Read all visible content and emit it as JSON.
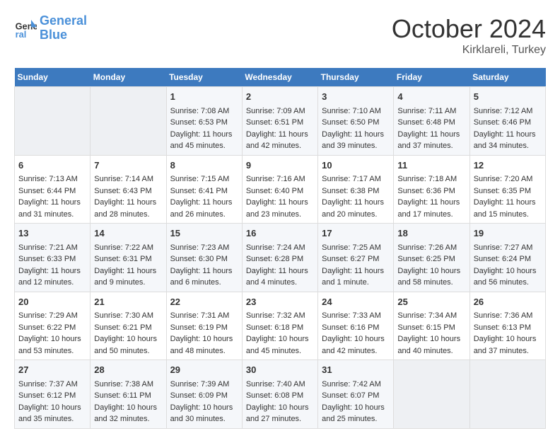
{
  "header": {
    "logo_line1": "General",
    "logo_line2": "Blue",
    "month": "October 2024",
    "location": "Kirklareli, Turkey"
  },
  "days_of_week": [
    "Sunday",
    "Monday",
    "Tuesday",
    "Wednesday",
    "Thursday",
    "Friday",
    "Saturday"
  ],
  "weeks": [
    [
      {
        "day": "",
        "data": []
      },
      {
        "day": "",
        "data": []
      },
      {
        "day": "1",
        "data": [
          "Sunrise: 7:08 AM",
          "Sunset: 6:53 PM",
          "Daylight: 11 hours and 45 minutes."
        ]
      },
      {
        "day": "2",
        "data": [
          "Sunrise: 7:09 AM",
          "Sunset: 6:51 PM",
          "Daylight: 11 hours and 42 minutes."
        ]
      },
      {
        "day": "3",
        "data": [
          "Sunrise: 7:10 AM",
          "Sunset: 6:50 PM",
          "Daylight: 11 hours and 39 minutes."
        ]
      },
      {
        "day": "4",
        "data": [
          "Sunrise: 7:11 AM",
          "Sunset: 6:48 PM",
          "Daylight: 11 hours and 37 minutes."
        ]
      },
      {
        "day": "5",
        "data": [
          "Sunrise: 7:12 AM",
          "Sunset: 6:46 PM",
          "Daylight: 11 hours and 34 minutes."
        ]
      }
    ],
    [
      {
        "day": "6",
        "data": [
          "Sunrise: 7:13 AM",
          "Sunset: 6:44 PM",
          "Daylight: 11 hours and 31 minutes."
        ]
      },
      {
        "day": "7",
        "data": [
          "Sunrise: 7:14 AM",
          "Sunset: 6:43 PM",
          "Daylight: 11 hours and 28 minutes."
        ]
      },
      {
        "day": "8",
        "data": [
          "Sunrise: 7:15 AM",
          "Sunset: 6:41 PM",
          "Daylight: 11 hours and 26 minutes."
        ]
      },
      {
        "day": "9",
        "data": [
          "Sunrise: 7:16 AM",
          "Sunset: 6:40 PM",
          "Daylight: 11 hours and 23 minutes."
        ]
      },
      {
        "day": "10",
        "data": [
          "Sunrise: 7:17 AM",
          "Sunset: 6:38 PM",
          "Daylight: 11 hours and 20 minutes."
        ]
      },
      {
        "day": "11",
        "data": [
          "Sunrise: 7:18 AM",
          "Sunset: 6:36 PM",
          "Daylight: 11 hours and 17 minutes."
        ]
      },
      {
        "day": "12",
        "data": [
          "Sunrise: 7:20 AM",
          "Sunset: 6:35 PM",
          "Daylight: 11 hours and 15 minutes."
        ]
      }
    ],
    [
      {
        "day": "13",
        "data": [
          "Sunrise: 7:21 AM",
          "Sunset: 6:33 PM",
          "Daylight: 11 hours and 12 minutes."
        ]
      },
      {
        "day": "14",
        "data": [
          "Sunrise: 7:22 AM",
          "Sunset: 6:31 PM",
          "Daylight: 11 hours and 9 minutes."
        ]
      },
      {
        "day": "15",
        "data": [
          "Sunrise: 7:23 AM",
          "Sunset: 6:30 PM",
          "Daylight: 11 hours and 6 minutes."
        ]
      },
      {
        "day": "16",
        "data": [
          "Sunrise: 7:24 AM",
          "Sunset: 6:28 PM",
          "Daylight: 11 hours and 4 minutes."
        ]
      },
      {
        "day": "17",
        "data": [
          "Sunrise: 7:25 AM",
          "Sunset: 6:27 PM",
          "Daylight: 11 hours and 1 minute."
        ]
      },
      {
        "day": "18",
        "data": [
          "Sunrise: 7:26 AM",
          "Sunset: 6:25 PM",
          "Daylight: 10 hours and 58 minutes."
        ]
      },
      {
        "day": "19",
        "data": [
          "Sunrise: 7:27 AM",
          "Sunset: 6:24 PM",
          "Daylight: 10 hours and 56 minutes."
        ]
      }
    ],
    [
      {
        "day": "20",
        "data": [
          "Sunrise: 7:29 AM",
          "Sunset: 6:22 PM",
          "Daylight: 10 hours and 53 minutes."
        ]
      },
      {
        "day": "21",
        "data": [
          "Sunrise: 7:30 AM",
          "Sunset: 6:21 PM",
          "Daylight: 10 hours and 50 minutes."
        ]
      },
      {
        "day": "22",
        "data": [
          "Sunrise: 7:31 AM",
          "Sunset: 6:19 PM",
          "Daylight: 10 hours and 48 minutes."
        ]
      },
      {
        "day": "23",
        "data": [
          "Sunrise: 7:32 AM",
          "Sunset: 6:18 PM",
          "Daylight: 10 hours and 45 minutes."
        ]
      },
      {
        "day": "24",
        "data": [
          "Sunrise: 7:33 AM",
          "Sunset: 6:16 PM",
          "Daylight: 10 hours and 42 minutes."
        ]
      },
      {
        "day": "25",
        "data": [
          "Sunrise: 7:34 AM",
          "Sunset: 6:15 PM",
          "Daylight: 10 hours and 40 minutes."
        ]
      },
      {
        "day": "26",
        "data": [
          "Sunrise: 7:36 AM",
          "Sunset: 6:13 PM",
          "Daylight: 10 hours and 37 minutes."
        ]
      }
    ],
    [
      {
        "day": "27",
        "data": [
          "Sunrise: 7:37 AM",
          "Sunset: 6:12 PM",
          "Daylight: 10 hours and 35 minutes."
        ]
      },
      {
        "day": "28",
        "data": [
          "Sunrise: 7:38 AM",
          "Sunset: 6:11 PM",
          "Daylight: 10 hours and 32 minutes."
        ]
      },
      {
        "day": "29",
        "data": [
          "Sunrise: 7:39 AM",
          "Sunset: 6:09 PM",
          "Daylight: 10 hours and 30 minutes."
        ]
      },
      {
        "day": "30",
        "data": [
          "Sunrise: 7:40 AM",
          "Sunset: 6:08 PM",
          "Daylight: 10 hours and 27 minutes."
        ]
      },
      {
        "day": "31",
        "data": [
          "Sunrise: 7:42 AM",
          "Sunset: 6:07 PM",
          "Daylight: 10 hours and 25 minutes."
        ]
      },
      {
        "day": "",
        "data": []
      },
      {
        "day": "",
        "data": []
      }
    ]
  ]
}
